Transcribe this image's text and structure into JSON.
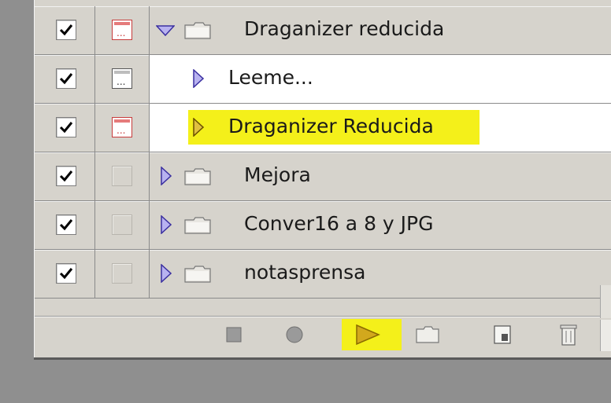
{
  "actions_panel": {
    "rows": [
      {
        "type": "set",
        "expanded": true,
        "checked": true,
        "dialog": "red",
        "label": "Draganizer reducida",
        "highlight": false
      },
      {
        "type": "action",
        "checked": true,
        "dialog": "dark",
        "label": "Leeme...",
        "highlight": false
      },
      {
        "type": "action",
        "checked": true,
        "dialog": "red",
        "label": "Draganizer Reducida",
        "highlight": true
      },
      {
        "type": "set",
        "expanded": false,
        "checked": true,
        "dialog": "none",
        "label": "Mejora",
        "highlight": false
      },
      {
        "type": "set",
        "expanded": false,
        "checked": true,
        "dialog": "none",
        "label": "Conver16 a 8 y JPG",
        "highlight": false
      },
      {
        "type": "set",
        "expanded": false,
        "checked": true,
        "dialog": "none",
        "label": "notasprensa",
        "highlight": false
      }
    ],
    "toolbar": {
      "buttons": [
        "stop-icon",
        "record-icon",
        "play-icon",
        "new-set-icon",
        "new-action-icon",
        "delete-icon"
      ],
      "highlighted": "play-icon"
    },
    "colors": {
      "panel_bg": "#d6d3cc",
      "highlight": "#f4f01a",
      "triangle": "#6a5acd",
      "dialog_red": "#c83b3b"
    }
  }
}
